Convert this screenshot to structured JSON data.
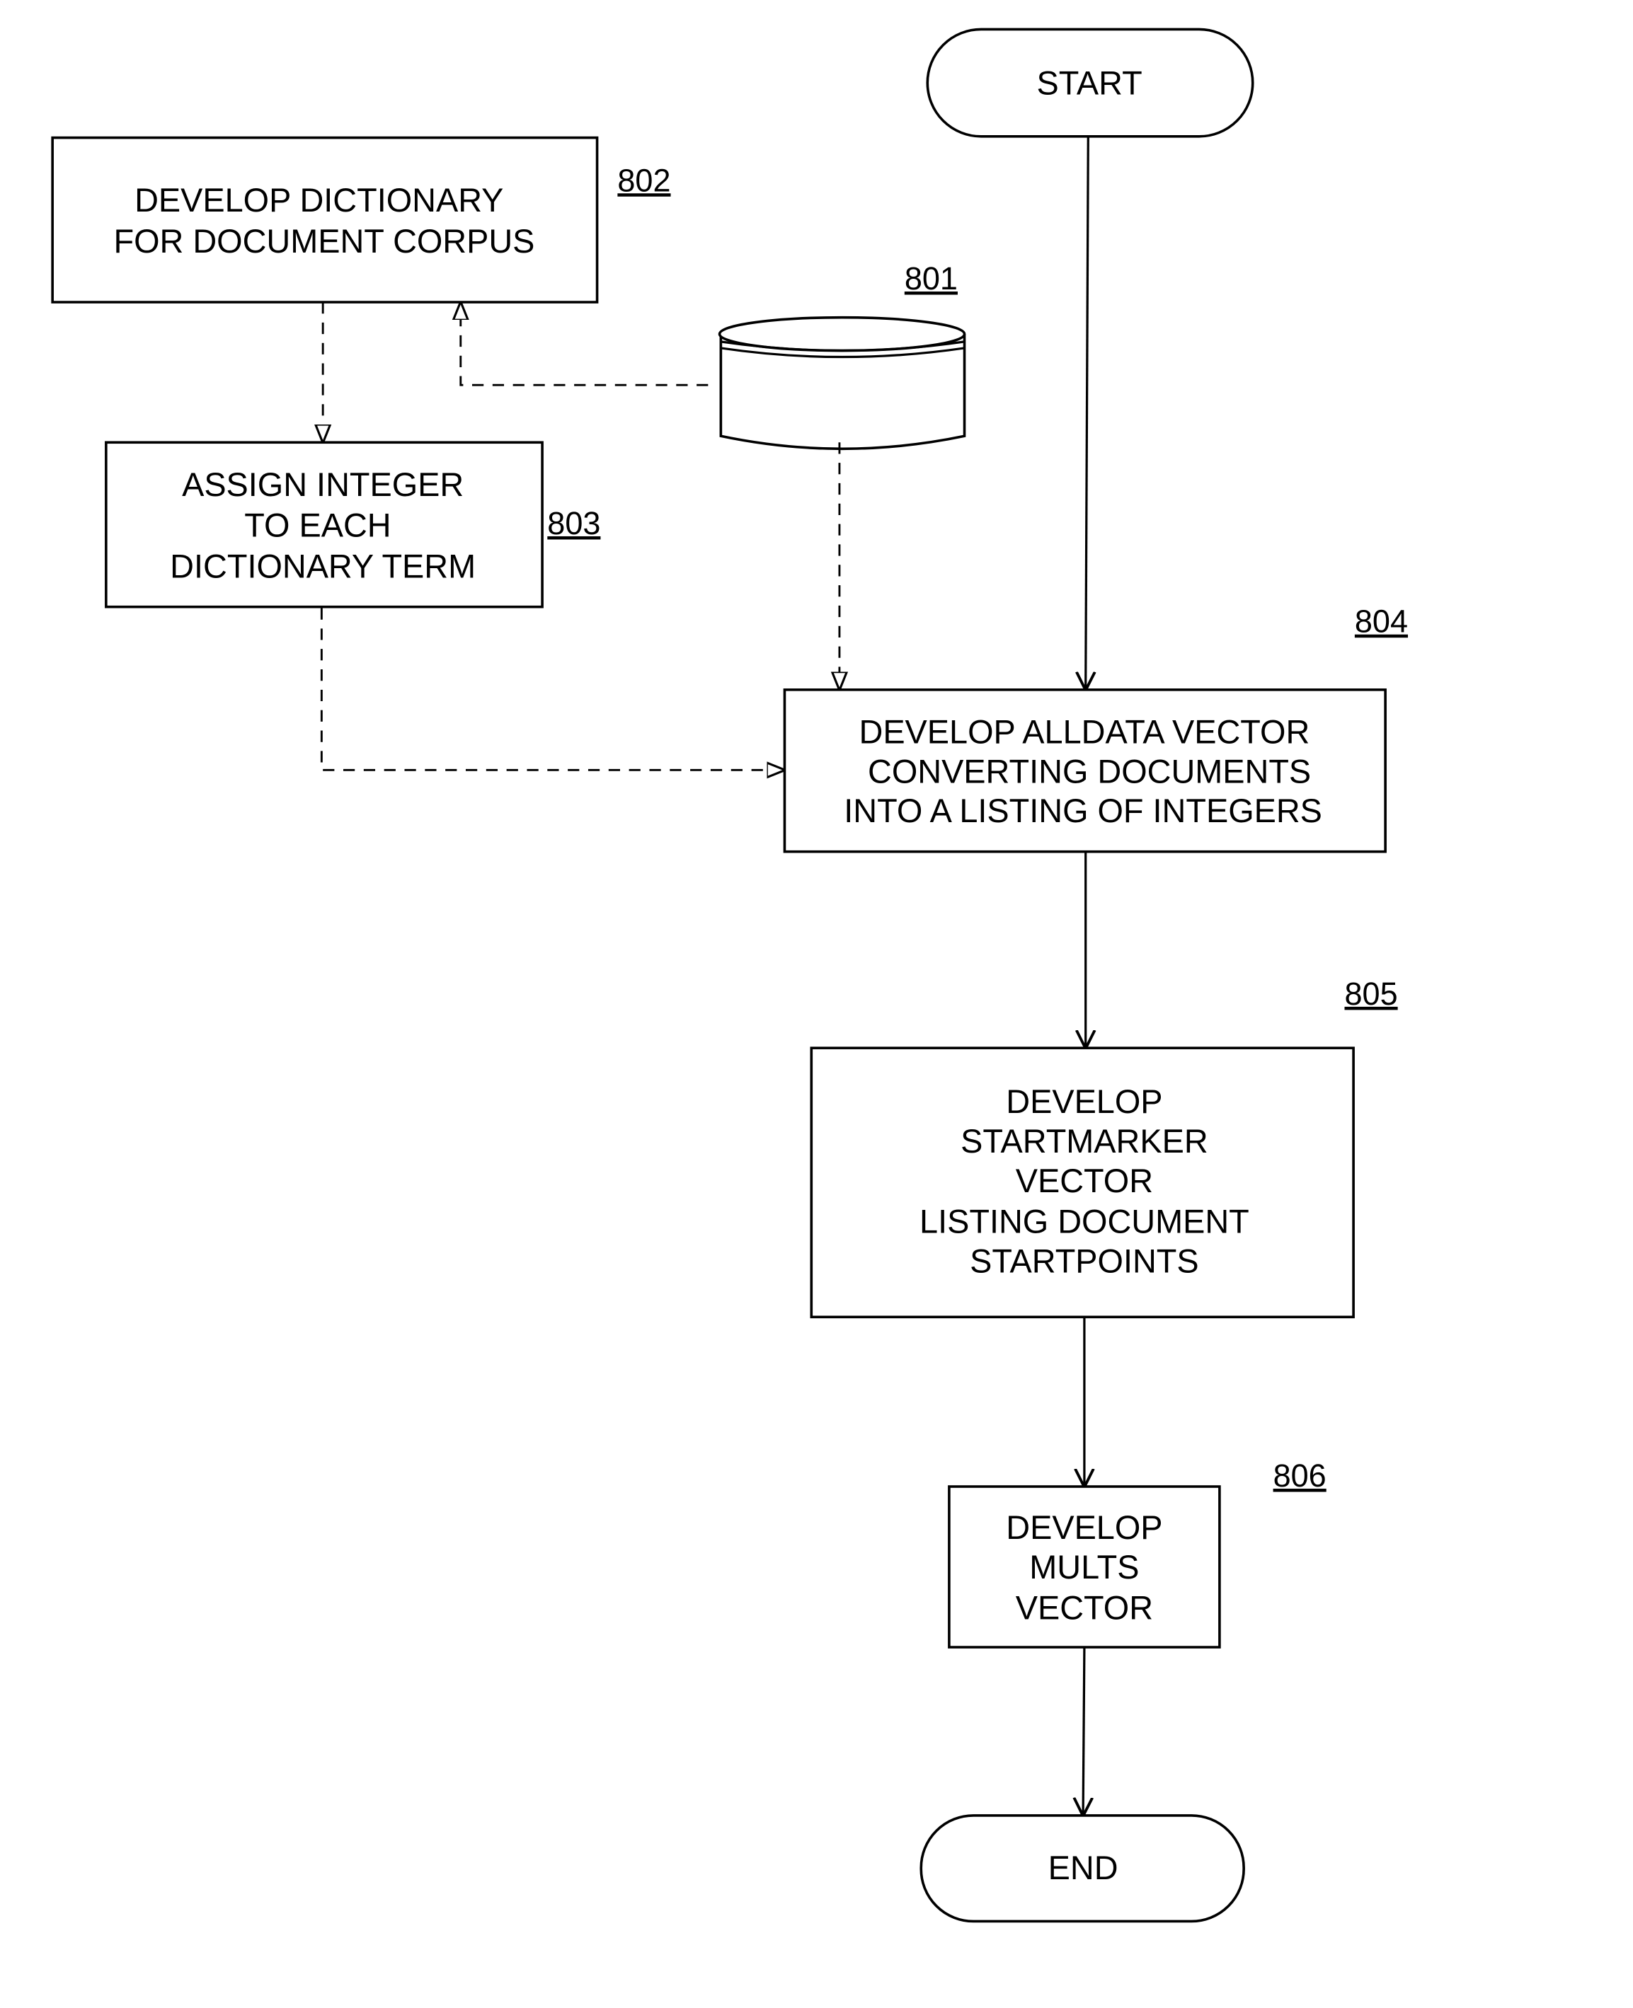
{
  "diagram": {
    "nodes": {
      "start": {
        "label": "START"
      },
      "end": {
        "label": "END"
      },
      "database": {
        "ref": "801"
      },
      "n802": {
        "ref": "802",
        "lines": [
          "DEVELOP DICTIONARY",
          "FOR DOCUMENT CORPUS"
        ]
      },
      "n803": {
        "ref": "803",
        "lines": [
          "ASSIGN INTEGER",
          "TO EACH",
          "DICTIONARY TERM"
        ]
      },
      "n804": {
        "ref": "804",
        "lines": [
          "DEVELOP ALLDATA VECTOR",
          "CONVERTING  DOCUMENTS",
          "INTO A LISTING OF  INTEGERS"
        ]
      },
      "n805": {
        "ref": "805",
        "lines": [
          "DEVELOP",
          "STARTMARKER",
          "VECTOR",
          "LISTING DOCUMENT",
          "STARTPOINTS"
        ]
      },
      "n806": {
        "ref": "806",
        "lines": [
          "DEVELOP",
          "MULTS",
          "VECTOR"
        ]
      }
    },
    "edges": [
      {
        "from": "start",
        "to": "n804",
        "style": "solid"
      },
      {
        "from": "database",
        "to": "n802",
        "style": "dashed"
      },
      {
        "from": "n802",
        "to": "n803",
        "style": "dashed"
      },
      {
        "from": "database",
        "to": "n804",
        "style": "dashed"
      },
      {
        "from": "n803",
        "to": "n804",
        "style": "dashed"
      },
      {
        "from": "n804",
        "to": "n805",
        "style": "solid"
      },
      {
        "from": "n805",
        "to": "n806",
        "style": "solid"
      },
      {
        "from": "n806",
        "to": "end",
        "style": "solid"
      }
    ]
  }
}
